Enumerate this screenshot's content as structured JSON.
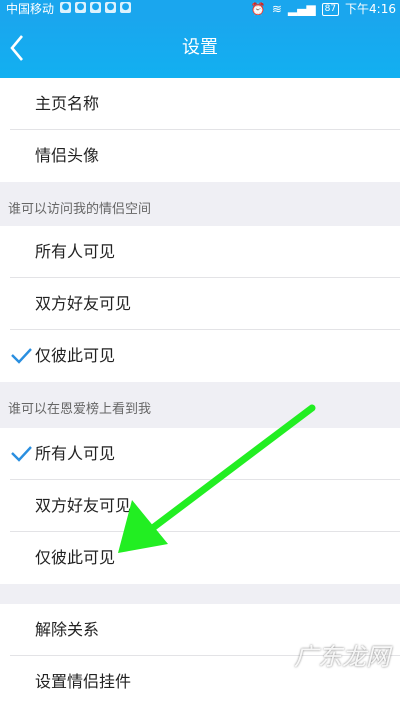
{
  "status_bar": {
    "carrier": "中国移动",
    "battery": "87",
    "time": "下午4:16"
  },
  "navbar": {
    "title": "设置",
    "back_icon": "chevron-left-icon"
  },
  "profile_section": {
    "items": [
      {
        "label": "主页名称"
      },
      {
        "label": "情侣头像"
      }
    ]
  },
  "visit_section": {
    "header": "谁可以访问我的情侣空间",
    "items": [
      {
        "label": "所有人可见"
      },
      {
        "label": "双方好友可见"
      },
      {
        "label": "仅彼此可见"
      }
    ],
    "selected": "仅彼此可见"
  },
  "ranking_section": {
    "header": "谁可以在恩爱榜上看到我",
    "items": [
      {
        "label": "所有人可见"
      },
      {
        "label": "双方好友可见"
      },
      {
        "label": "仅彼此可见"
      }
    ],
    "selected": "所有人可见"
  },
  "relation_section": {
    "items": [
      {
        "label": "解除关系"
      },
      {
        "label": "设置情侣挂件"
      }
    ]
  },
  "annotation": {
    "arrow_color": "#22ee22",
    "watermark": "广东龙网"
  },
  "colors": {
    "accent": "#1aa6ee",
    "checkmark": "#2a8fe0"
  }
}
